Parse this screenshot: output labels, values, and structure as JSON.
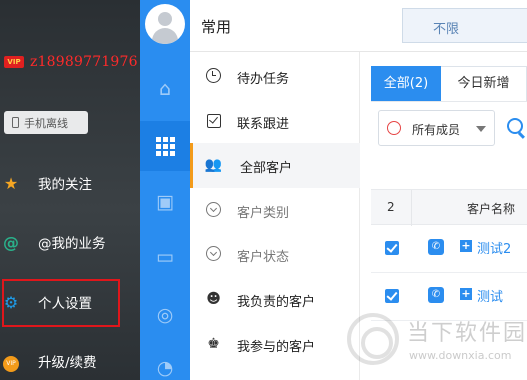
{
  "left_menu": {
    "vip_badge": "VIP",
    "username": "z18989771976",
    "offline_button": "手机离线",
    "items": [
      {
        "label": "我的关注",
        "icon": "star-icon"
      },
      {
        "label": "@我的业务",
        "icon": "at-icon"
      },
      {
        "label": "个人设置",
        "icon": "gear-icon"
      },
      {
        "label": "升级/续费",
        "icon": "vip-icon"
      }
    ]
  },
  "rail": {
    "items": [
      "home-icon",
      "grid-icon",
      "apps-icon",
      "monitor-icon",
      "chart-icon",
      "pie-icon"
    ],
    "active_index": 1
  },
  "header": {
    "title": "常用",
    "filter_label": "不限"
  },
  "submenu": {
    "items": [
      {
        "label": "待办任务"
      },
      {
        "label": "联系跟进"
      },
      {
        "label": "全部客户"
      },
      {
        "label": "客户类别"
      },
      {
        "label": "客户状态"
      },
      {
        "label": "我负责的客户"
      },
      {
        "label": "我参与的客户"
      }
    ],
    "active_index": 2
  },
  "main": {
    "tabs": [
      {
        "label": "全部(2)"
      },
      {
        "label": "今日新增"
      }
    ],
    "member_filter": "所有成员",
    "table": {
      "count": "2",
      "column_name": "客户名称",
      "rows": [
        {
          "name": "测试2"
        },
        {
          "name": "测试"
        }
      ]
    }
  },
  "watermark": {
    "text": "当下软件园",
    "url": "www.downxia.com"
  },
  "colors": {
    "accent_blue": "#2b8def",
    "highlight_orange": "#f39b1a",
    "alert_red": "#e0161b"
  }
}
